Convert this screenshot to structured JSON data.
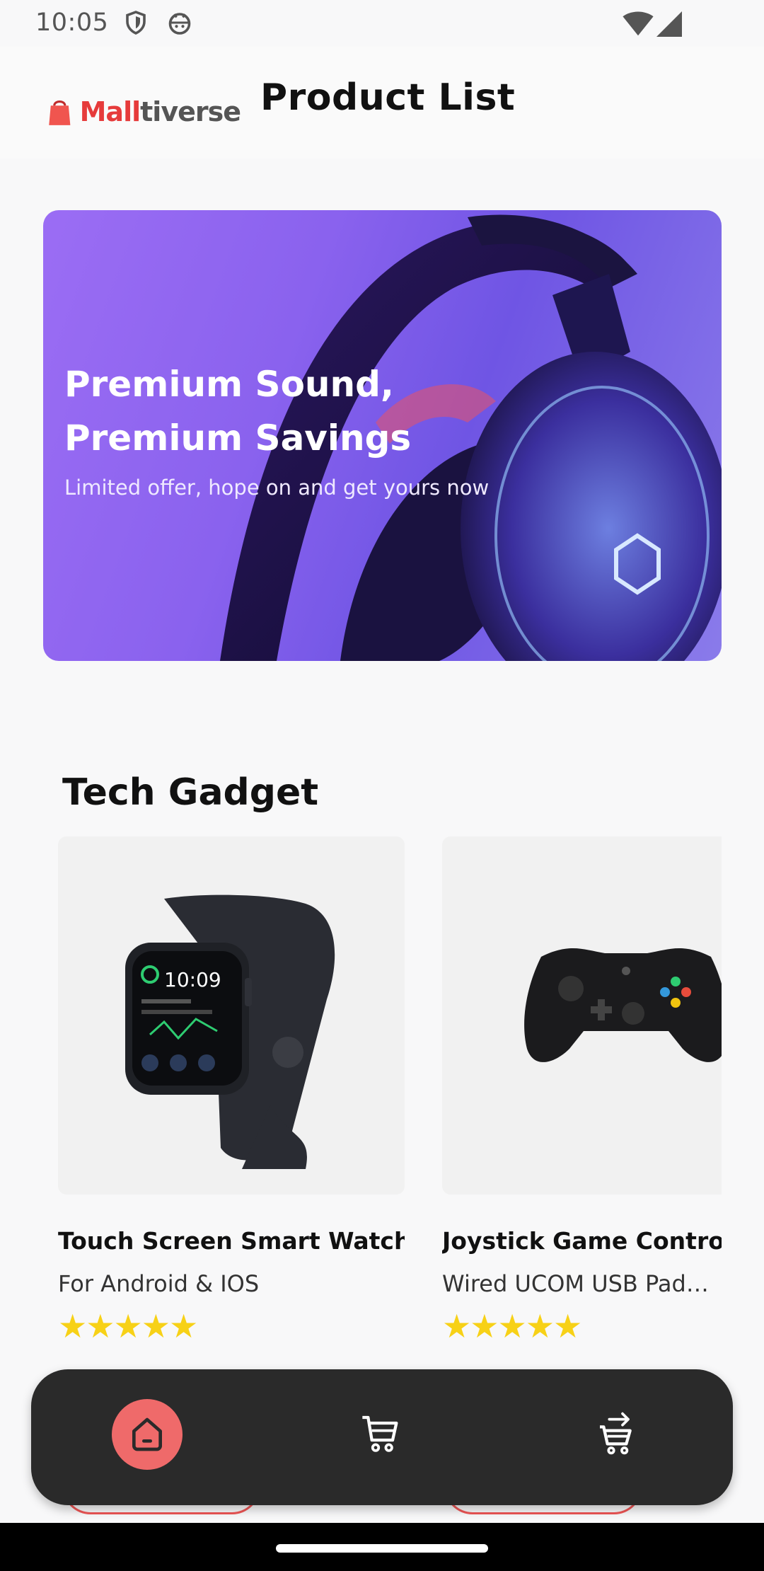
{
  "status_bar": {
    "time": "10:05",
    "icons": [
      "shield-icon",
      "android-icon",
      "wifi-icon",
      "signal-icon"
    ]
  },
  "header": {
    "logo": {
      "part1": "Mall",
      "part2": "tiverse",
      "icon": "shopping-bag-icon"
    },
    "title": "Product List"
  },
  "banner": {
    "headline": "Premium Sound,\nPremium Savings",
    "subline": "Limited offer, hope on and get yours now",
    "image": "headphones-image"
  },
  "section": {
    "title": "Tech Gadget"
  },
  "products": [
    {
      "name": "Touch Screen Smart Watch",
      "description": "For Android & IOS",
      "rating": "★★★★★",
      "image": "smart-watch-image"
    },
    {
      "name": "Joystick Game Controll",
      "description": "Wired UCOM USB Pad…",
      "rating": "★★★★★",
      "image": "game-controller-image"
    }
  ],
  "bottom_nav": {
    "items": [
      {
        "icon": "home-icon",
        "active": true
      },
      {
        "icon": "cart-icon",
        "active": false
      },
      {
        "icon": "checkout-cart-icon",
        "active": false
      }
    ]
  },
  "colors": {
    "accent": "#ef6a6a",
    "nav_background": "#2a2a2a",
    "star": "#f7d117",
    "banner": "#8a62ee"
  }
}
